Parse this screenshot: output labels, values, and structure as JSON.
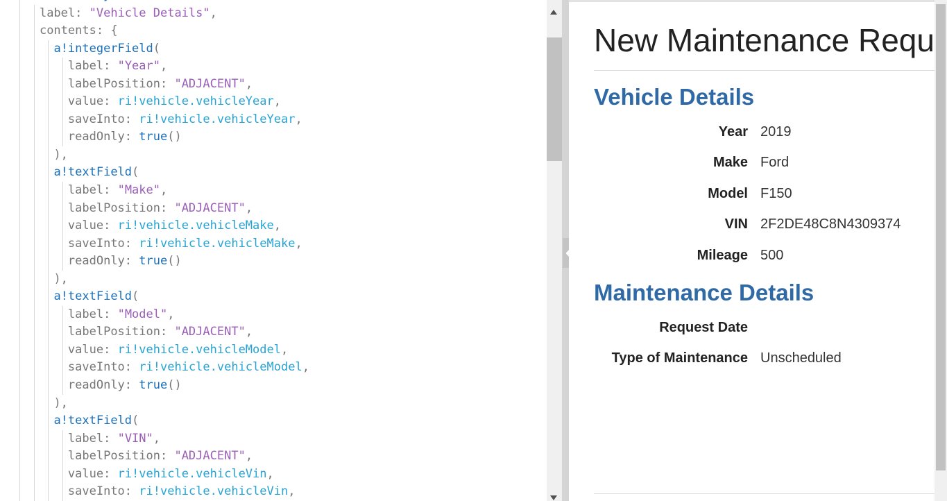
{
  "editor": {
    "lines": [
      [
        {
          "t": "a!sectionLayout(",
          "c": "fn"
        }
      ],
      [
        {
          "t": "label",
          "c": "p"
        },
        {
          "t": ": ",
          "c": "p"
        },
        {
          "t": "\"Vehicle Details\"",
          "c": "str"
        },
        {
          "t": ",",
          "c": "p"
        }
      ],
      [
        {
          "t": "contents",
          "c": "p"
        },
        {
          "t": ": {",
          "c": "p"
        }
      ],
      [
        {
          "t": "a!integerField",
          "c": "fn"
        },
        {
          "t": "(",
          "c": "p"
        }
      ],
      [
        {
          "t": "label",
          "c": "p"
        },
        {
          "t": ": ",
          "c": "p"
        },
        {
          "t": "\"Year\"",
          "c": "str"
        },
        {
          "t": ",",
          "c": "p"
        }
      ],
      [
        {
          "t": "labelPosition",
          "c": "p"
        },
        {
          "t": ": ",
          "c": "p"
        },
        {
          "t": "\"ADJACENT\"",
          "c": "str"
        },
        {
          "t": ",",
          "c": "p"
        }
      ],
      [
        {
          "t": "value",
          "c": "p"
        },
        {
          "t": ": ",
          "c": "p"
        },
        {
          "t": "ri!vehicle.vehicleYear",
          "c": "ri"
        },
        {
          "t": ",",
          "c": "p"
        }
      ],
      [
        {
          "t": "saveInto",
          "c": "p"
        },
        {
          "t": ": ",
          "c": "p"
        },
        {
          "t": "ri!vehicle.vehicleYear",
          "c": "ri"
        },
        {
          "t": ",",
          "c": "p"
        }
      ],
      [
        {
          "t": "readOnly",
          "c": "p"
        },
        {
          "t": ": ",
          "c": "p"
        },
        {
          "t": "true",
          "c": "kw"
        },
        {
          "t": "()",
          "c": "p"
        }
      ],
      [
        {
          "t": "),",
          "c": "p"
        }
      ],
      [
        {
          "t": "a!textField",
          "c": "fn"
        },
        {
          "t": "(",
          "c": "p"
        }
      ],
      [
        {
          "t": "label",
          "c": "p"
        },
        {
          "t": ": ",
          "c": "p"
        },
        {
          "t": "\"Make\"",
          "c": "str"
        },
        {
          "t": ",",
          "c": "p"
        }
      ],
      [
        {
          "t": "labelPosition",
          "c": "p"
        },
        {
          "t": ": ",
          "c": "p"
        },
        {
          "t": "\"ADJACENT\"",
          "c": "str"
        },
        {
          "t": ",",
          "c": "p"
        }
      ],
      [
        {
          "t": "value",
          "c": "p"
        },
        {
          "t": ": ",
          "c": "p"
        },
        {
          "t": "ri!vehicle.vehicleMake",
          "c": "ri"
        },
        {
          "t": ",",
          "c": "p"
        }
      ],
      [
        {
          "t": "saveInto",
          "c": "p"
        },
        {
          "t": ": ",
          "c": "p"
        },
        {
          "t": "ri!vehicle.vehicleMake",
          "c": "ri"
        },
        {
          "t": ",",
          "c": "p"
        }
      ],
      [
        {
          "t": "readOnly",
          "c": "p"
        },
        {
          "t": ": ",
          "c": "p"
        },
        {
          "t": "true",
          "c": "kw"
        },
        {
          "t": "()",
          "c": "p"
        }
      ],
      [
        {
          "t": "),",
          "c": "p"
        }
      ],
      [
        {
          "t": "a!textField",
          "c": "fn"
        },
        {
          "t": "(",
          "c": "p"
        }
      ],
      [
        {
          "t": "label",
          "c": "p"
        },
        {
          "t": ": ",
          "c": "p"
        },
        {
          "t": "\"Model\"",
          "c": "str"
        },
        {
          "t": ",",
          "c": "p"
        }
      ],
      [
        {
          "t": "labelPosition",
          "c": "p"
        },
        {
          "t": ": ",
          "c": "p"
        },
        {
          "t": "\"ADJACENT\"",
          "c": "str"
        },
        {
          "t": ",",
          "c": "p"
        }
      ],
      [
        {
          "t": "value",
          "c": "p"
        },
        {
          "t": ": ",
          "c": "p"
        },
        {
          "t": "ri!vehicle.vehicleModel",
          "c": "ri"
        },
        {
          "t": ",",
          "c": "p"
        }
      ],
      [
        {
          "t": "saveInto",
          "c": "p"
        },
        {
          "t": ": ",
          "c": "p"
        },
        {
          "t": "ri!vehicle.vehicleModel",
          "c": "ri"
        },
        {
          "t": ",",
          "c": "p"
        }
      ],
      [
        {
          "t": "readOnly",
          "c": "p"
        },
        {
          "t": ": ",
          "c": "p"
        },
        {
          "t": "true",
          "c": "kw"
        },
        {
          "t": "()",
          "c": "p"
        }
      ],
      [
        {
          "t": "),",
          "c": "p"
        }
      ],
      [
        {
          "t": "a!textField",
          "c": "fn"
        },
        {
          "t": "(",
          "c": "p"
        }
      ],
      [
        {
          "t": "label",
          "c": "p"
        },
        {
          "t": ": ",
          "c": "p"
        },
        {
          "t": "\"VIN\"",
          "c": "str"
        },
        {
          "t": ",",
          "c": "p"
        }
      ],
      [
        {
          "t": "labelPosition",
          "c": "p"
        },
        {
          "t": ": ",
          "c": "p"
        },
        {
          "t": "\"ADJACENT\"",
          "c": "str"
        },
        {
          "t": ",",
          "c": "p"
        }
      ],
      [
        {
          "t": "value",
          "c": "p"
        },
        {
          "t": ": ",
          "c": "p"
        },
        {
          "t": "ri!vehicle.vehicleVin",
          "c": "ri"
        },
        {
          "t": ",",
          "c": "p"
        }
      ],
      [
        {
          "t": "saveInto",
          "c": "p"
        },
        {
          "t": ": ",
          "c": "p"
        },
        {
          "t": "ri!vehicle.vehicleVin",
          "c": "ri"
        },
        {
          "t": ",",
          "c": "p"
        }
      ]
    ],
    "indents": [
      2,
      3,
      3,
      4,
      5,
      5,
      5,
      5,
      5,
      4,
      4,
      5,
      5,
      5,
      5,
      5,
      4,
      4,
      5,
      5,
      5,
      5,
      5,
      4,
      4,
      5,
      5,
      5,
      5
    ]
  },
  "preview": {
    "title": "New Maintenance Request",
    "sections": [
      {
        "heading": "Vehicle Details",
        "fields": [
          {
            "label": "Year",
            "value": "2019"
          },
          {
            "label": "Make",
            "value": "Ford"
          },
          {
            "label": "Model",
            "value": "F150"
          },
          {
            "label": "VIN",
            "value": "2F2DE48C8N4309374"
          },
          {
            "label": "Mileage",
            "value": "500"
          }
        ]
      },
      {
        "heading": "Maintenance Details",
        "fields": [
          {
            "label": "Request Date",
            "value": ""
          },
          {
            "label": "Type of Maintenance",
            "value": "Unscheduled"
          }
        ]
      }
    ]
  },
  "colors": {
    "heading": "#2f6aa6",
    "function": "#1b6fb7",
    "string": "#9b5fb8",
    "rule_input": "#27a3d4"
  },
  "icons": {
    "collapse_handle": "arrow-left-icon"
  }
}
